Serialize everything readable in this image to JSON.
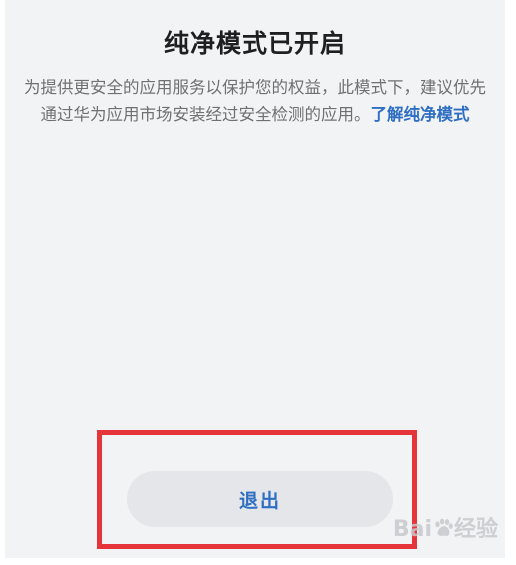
{
  "dialog": {
    "title": "纯净模式已开启",
    "description": "为提供更安全的应用服务以保护您的权益，此模式下，建议优先通过华为应用市场安装经过安全检测的应用。",
    "learn_more_link": "了解纯净模式",
    "exit_button": "退出"
  },
  "watermark": {
    "text_before": "Bai",
    "text_after": "经验"
  },
  "colors": {
    "accent_blue": "#2f6fc3",
    "highlight_red": "#e5353b",
    "background": "#f2f3f5",
    "button_bg": "#e4e6ea"
  }
}
